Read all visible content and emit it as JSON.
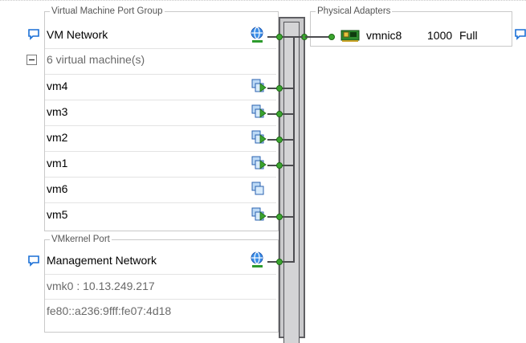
{
  "vm_port_group": {
    "legend": "Virtual Machine Port Group",
    "network_name": "VM Network",
    "vm_count_label": "6 virtual machine(s)",
    "collapse_glyph": "−",
    "vms": [
      {
        "name": "vm4",
        "connected": true
      },
      {
        "name": "vm3",
        "connected": true
      },
      {
        "name": "vm2",
        "connected": true
      },
      {
        "name": "vm1",
        "connected": true
      },
      {
        "name": "vm6",
        "connected": false
      },
      {
        "name": "vm5",
        "connected": true
      }
    ]
  },
  "vmkernel_port": {
    "legend": "VMkernel Port",
    "network_name": "Management Network",
    "ipv4": "vmk0 : 10.13.249.217",
    "ipv6": "fe80::a236:9fff:fe07:4d18"
  },
  "physical_adapters": {
    "legend": "Physical Adapters",
    "adapters": [
      {
        "name": "vmnic8",
        "speed": "1000",
        "duplex": "Full"
      }
    ]
  },
  "icons": {
    "comment": "speech-bubble-icon",
    "network": "globe-network-icon",
    "vm": "virtual-machine-icon",
    "nic": "network-card-icon",
    "collapse": "minus-box-icon"
  },
  "colors": {
    "link_green": "#3aa52e",
    "switch_gray": "#c9c9cb",
    "bubble_blue": "#1a6fd6",
    "border_gray": "#c9c9c9"
  }
}
